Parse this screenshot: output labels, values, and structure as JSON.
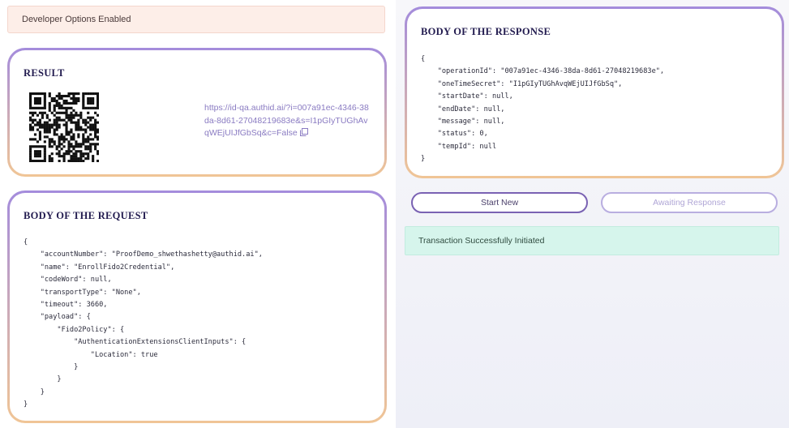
{
  "banner": {
    "text": "Developer Options Enabled"
  },
  "result": {
    "title": "RESULT",
    "link": "https://id-qa.authid.ai/?i=007a91ec-4346-38da-8d61-27048219683e&s=I1pGIyTUGhAvqWEjUIJfGbSq&c=False",
    "copy_icon": "copy-icon"
  },
  "request": {
    "title": "BODY OF THE REQUEST",
    "lines": [
      "{",
      "    \"accountNumber\": \"ProofDemo_shwethashetty@authid.ai\",",
      "    \"name\": \"EnrollFido2Credential\",",
      "    \"codeWord\": null,",
      "    \"transportType\": \"None\",",
      "    \"timeout\": 3660,",
      "    \"payload\": {",
      "        \"Fido2Policy\": {",
      "            \"AuthenticationExtensionsClientInputs\": {",
      "                \"Location\": true",
      "            }",
      "        }",
      "    }",
      "}"
    ]
  },
  "response": {
    "title": "BODY OF THE RESPONSE",
    "lines": [
      "{",
      "    \"operationId\": \"007a91ec-4346-38da-8d61-27048219683e\",",
      "    \"oneTimeSecret\": \"I1pGIyTUGhAvqWEjUIJfGbSq\",",
      "    \"startDate\": null,",
      "    \"endDate\": null,",
      "    \"message\": null,",
      "    \"status\": 0,",
      "    \"tempId\": null",
      "}"
    ]
  },
  "actions": {
    "start_new": "Start New",
    "awaiting": "Awaiting Response"
  },
  "status": {
    "message": "Transaction Successfully Initiated"
  },
  "colors": {
    "card_border_top": "#a48cdc",
    "card_border_bottom": "#f0c596",
    "success_bg": "#d6f5ec",
    "banner_bg": "#fdeee8",
    "link": "#8a7bc2"
  }
}
